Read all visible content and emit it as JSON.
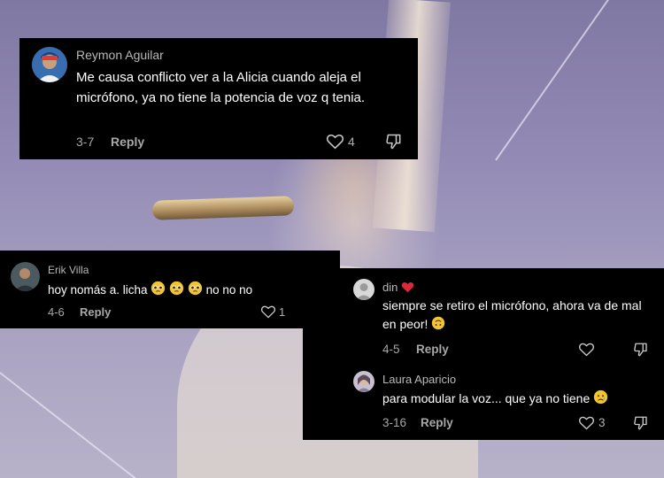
{
  "comments": [
    {
      "user": "Reymon Aguilar",
      "text": "Me causa conflicto ver a la Alicia cuando aleja el micrófono, ya no tiene la potencia de voz q tenia.",
      "date": "3-7",
      "reply": "Reply",
      "likes": "4"
    },
    {
      "user": "Erik Villa",
      "text": "hoy nomás a. licha",
      "text_suffix": " no no no",
      "date": "4-6",
      "reply": "Reply",
      "likes": "1"
    },
    {
      "user": "din",
      "text": "siempre se retiro el micrófono, ahora va de mal en peor!",
      "date": "4-5",
      "reply": "Reply",
      "likes": ""
    },
    {
      "user": "Laura Aparicio",
      "text": "para modular la voz... que ya no tiene",
      "date": "3-16",
      "reply": "Reply",
      "likes": "3"
    }
  ],
  "colors": {
    "card_bg": "#000000",
    "username": "#b9b9b9",
    "meta": "#a8a8a8",
    "heart_red": "#e0263a",
    "emoji_yellow": "#f4c430"
  },
  "icons": [
    "heart-outline-icon",
    "dislike-icon",
    "pleading-face-emoji",
    "upside-down-face-emoji",
    "sad-face-emoji",
    "red-heart-emoji"
  ]
}
